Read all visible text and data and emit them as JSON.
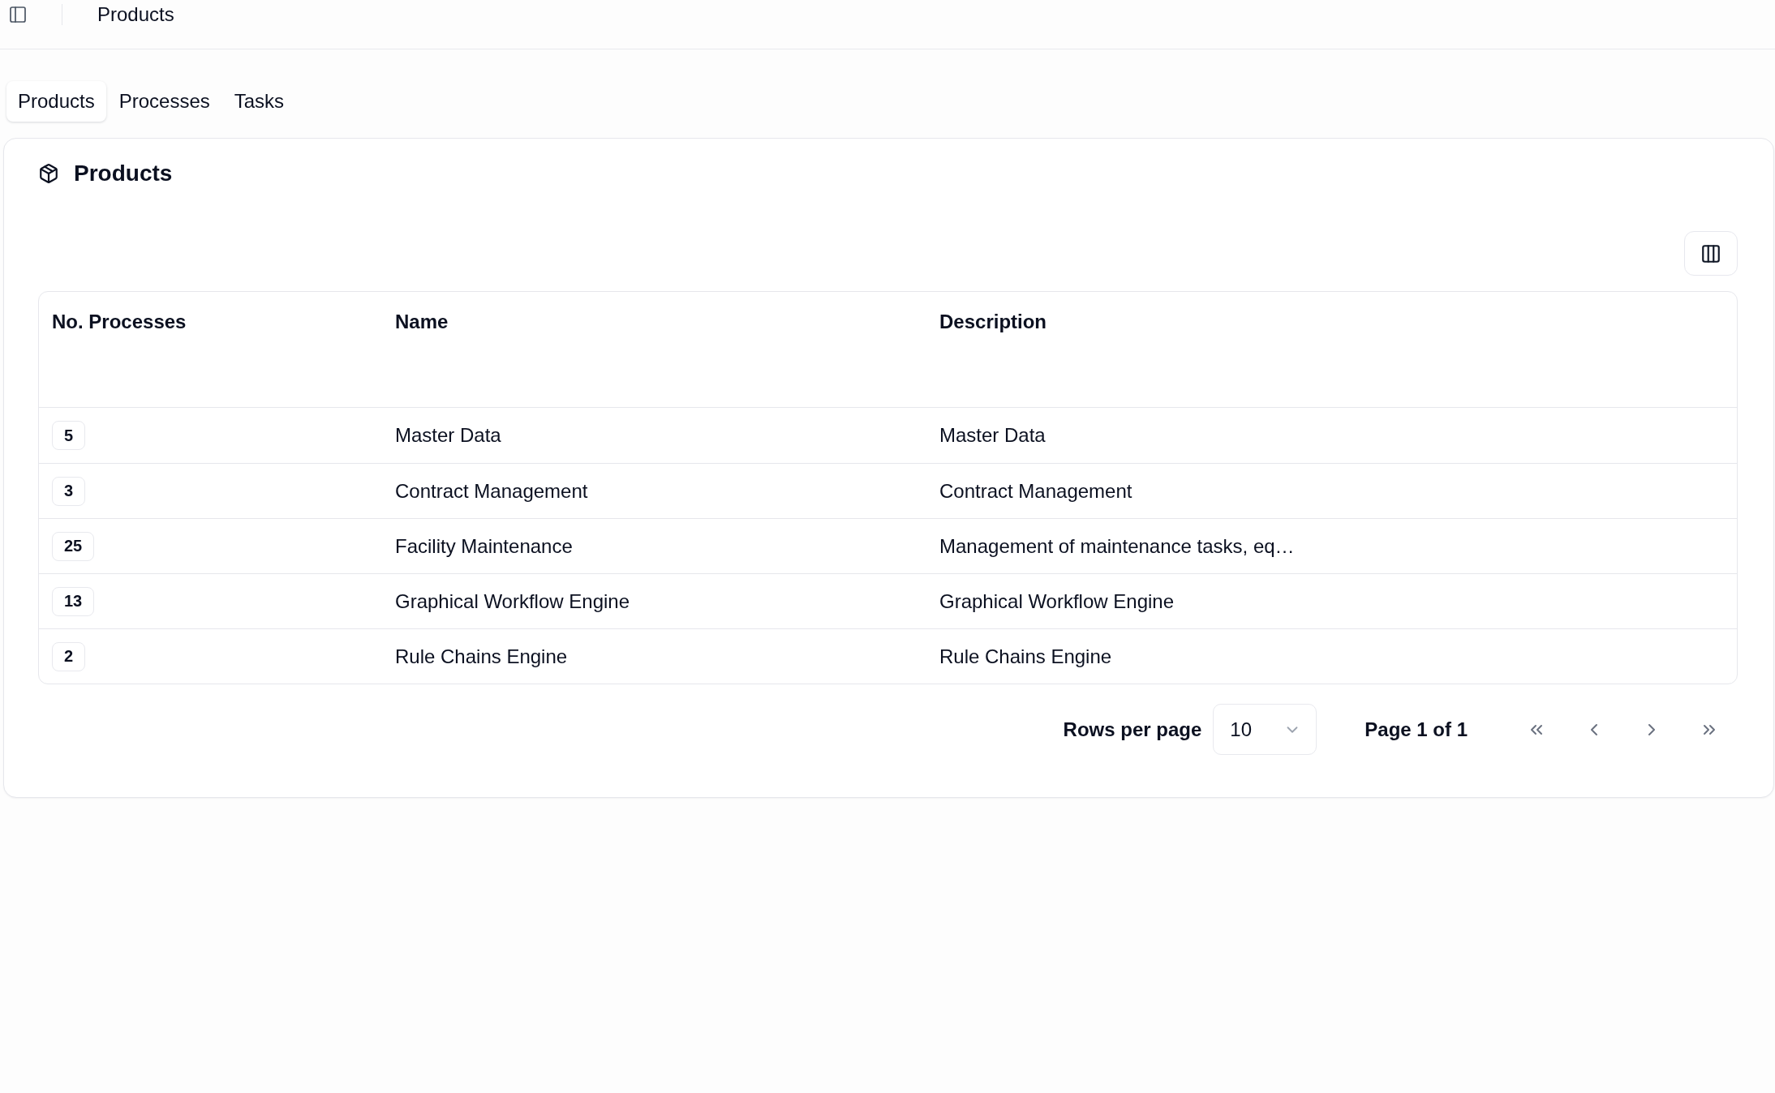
{
  "header": {
    "title": "Products"
  },
  "tabs": [
    {
      "label": "Products",
      "selected": true
    },
    {
      "label": "Processes",
      "selected": false
    },
    {
      "label": "Tasks",
      "selected": false
    }
  ],
  "card": {
    "title": "Products"
  },
  "table": {
    "columns": [
      "No. Processes",
      "Name",
      "Description"
    ],
    "rows": [
      {
        "process_count": "5",
        "name": "Master Data",
        "description": "Master Data"
      },
      {
        "process_count": "3",
        "name": "Contract Management",
        "description": "Contract Management"
      },
      {
        "process_count": "25",
        "name": "Facility Maintenance",
        "description": "Management of maintenance tasks, eq…"
      },
      {
        "process_count": "13",
        "name": "Graphical Workflow Engine",
        "description": "Graphical Workflow Engine"
      },
      {
        "process_count": "2",
        "name": "Rule Chains Engine",
        "description": "Rule Chains Engine"
      }
    ]
  },
  "pagination": {
    "rows_per_page_label": "Rows per page",
    "rows_per_page": "10",
    "page_label": "Page 1 of 1",
    "buttons": [
      {
        "kind": "first",
        "disabled": true
      },
      {
        "kind": "previous",
        "disabled": true
      },
      {
        "kind": "next",
        "disabled": true
      },
      {
        "kind": "last",
        "disabled": true
      }
    ]
  }
}
